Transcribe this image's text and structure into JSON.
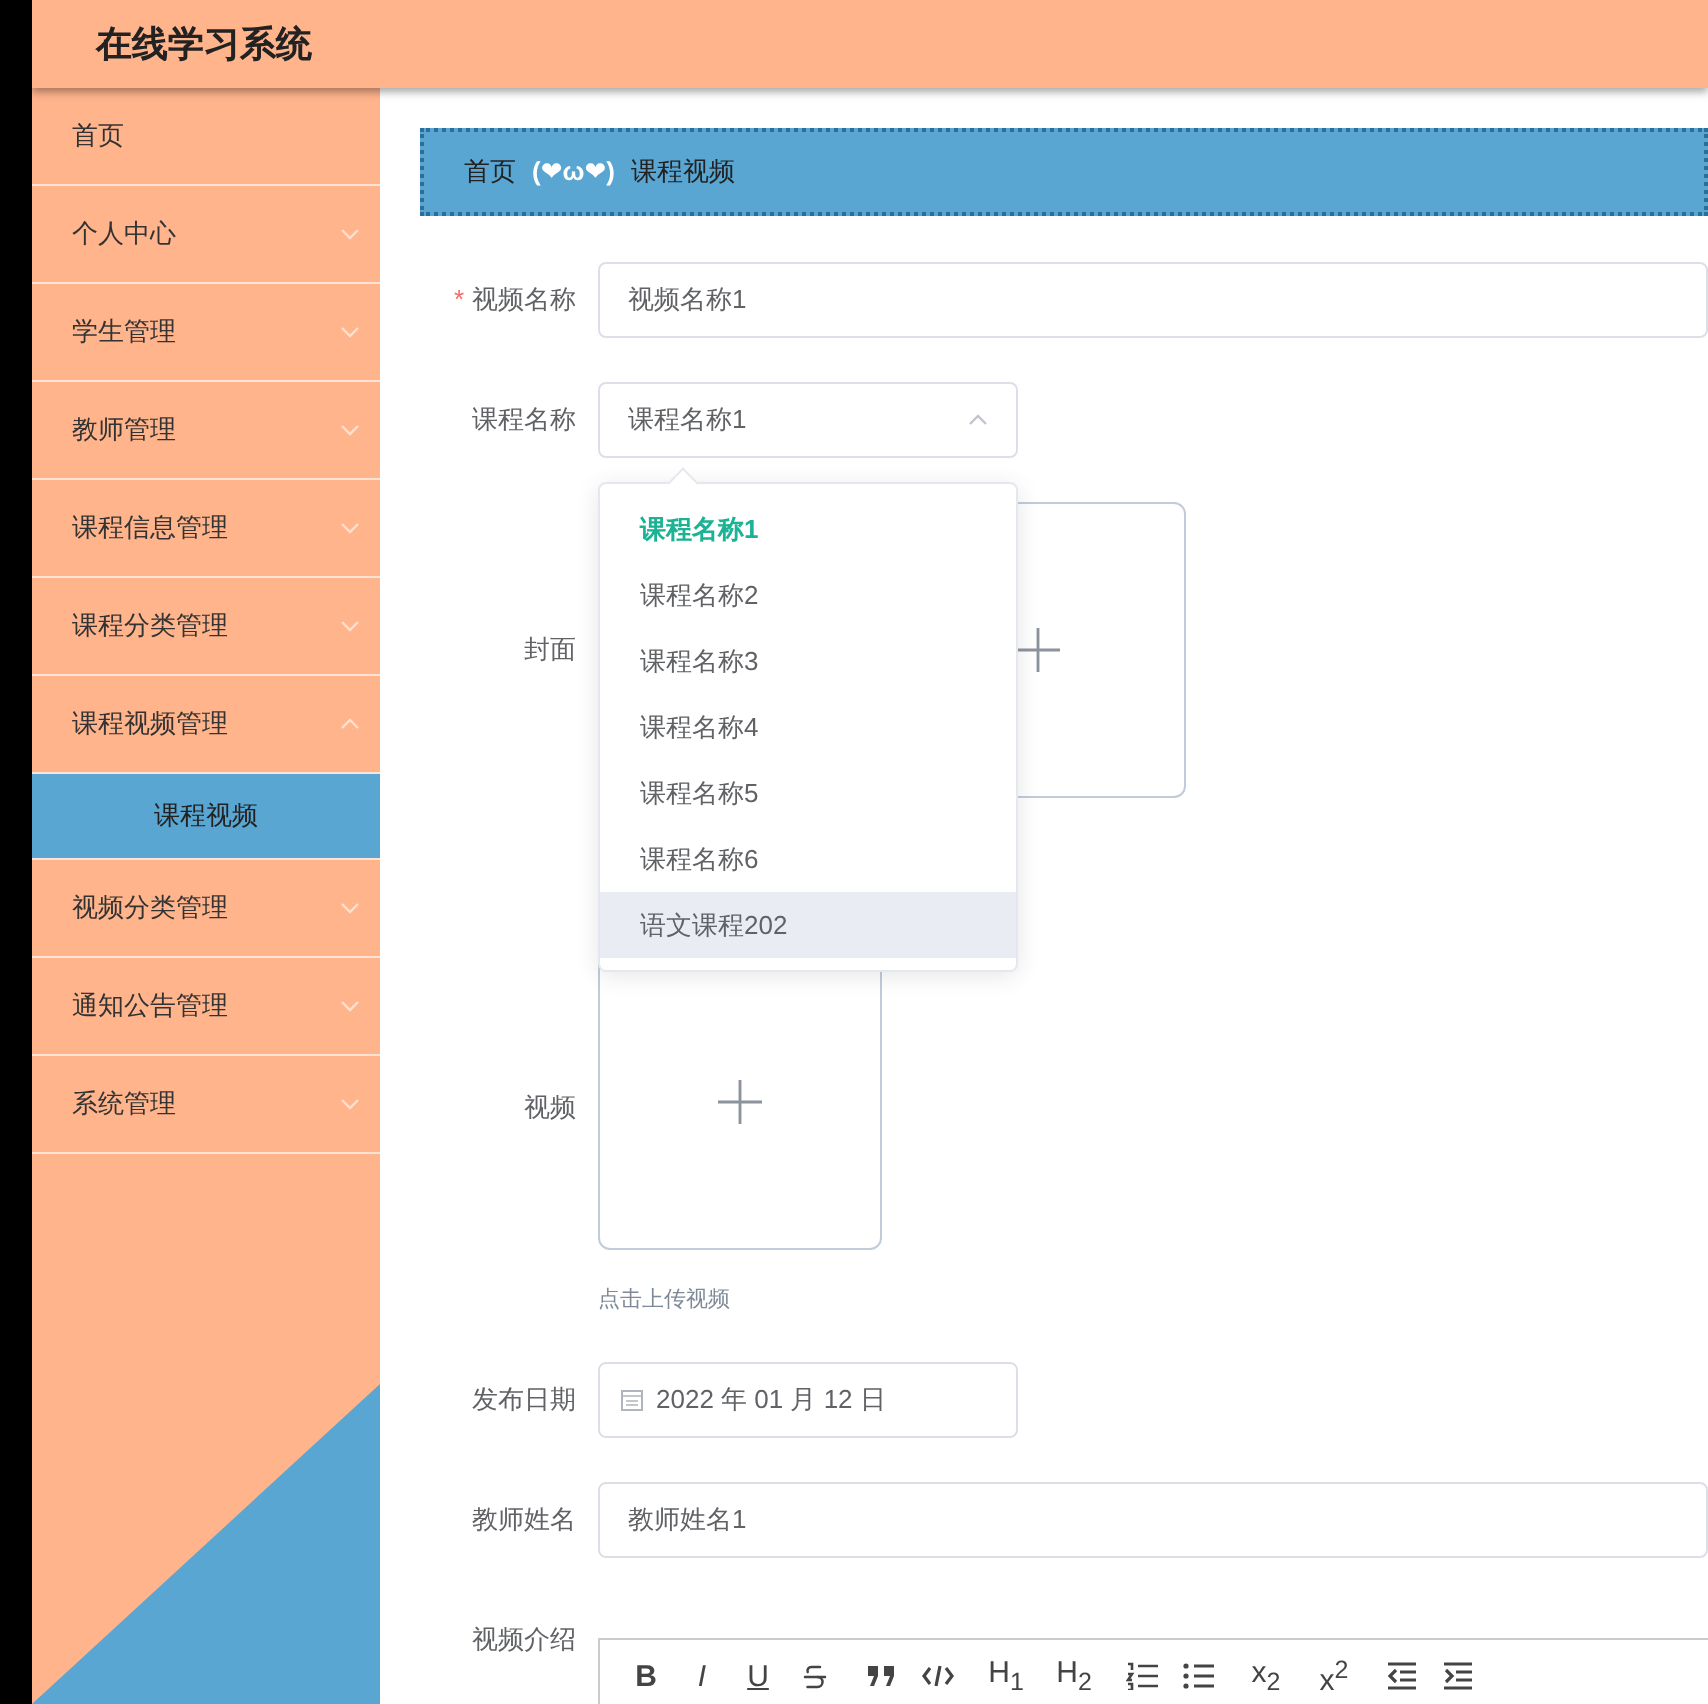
{
  "header": {
    "title": "在线学习系统"
  },
  "sidebar": {
    "items": [
      {
        "label": "首页",
        "kind": "link"
      },
      {
        "label": "个人中心",
        "kind": "menu",
        "expanded": false
      },
      {
        "label": "学生管理",
        "kind": "menu",
        "expanded": false
      },
      {
        "label": "教师管理",
        "kind": "menu",
        "expanded": false
      },
      {
        "label": "课程信息管理",
        "kind": "menu",
        "expanded": false
      },
      {
        "label": "课程分类管理",
        "kind": "menu",
        "expanded": false
      },
      {
        "label": "课程视频管理",
        "kind": "menu",
        "expanded": true,
        "children": [
          {
            "label": "课程视频",
            "selected": true
          }
        ]
      },
      {
        "label": "视频分类管理",
        "kind": "menu",
        "expanded": false
      },
      {
        "label": "通知公告管理",
        "kind": "menu",
        "expanded": false
      },
      {
        "label": "系统管理",
        "kind": "menu",
        "expanded": false
      }
    ]
  },
  "breadcrumb": {
    "home": "首页",
    "separator": "(❤ω❤)",
    "current": "课程视频"
  },
  "form": {
    "video_name": {
      "label": "视频名称",
      "required_mark": "*",
      "value": "视频名称1"
    },
    "course_name": {
      "label": "课程名称",
      "value": "课程名称1",
      "expanded": true,
      "options": [
        {
          "label": "课程名称1",
          "selected": true,
          "hovered": false
        },
        {
          "label": "课程名称2",
          "selected": false,
          "hovered": false
        },
        {
          "label": "课程名称3",
          "selected": false,
          "hovered": false
        },
        {
          "label": "课程名称4",
          "selected": false,
          "hovered": false
        },
        {
          "label": "课程名称5",
          "selected": false,
          "hovered": false
        },
        {
          "label": "课程名称6",
          "selected": false,
          "hovered": false
        },
        {
          "label": "语文课程202",
          "selected": false,
          "hovered": true
        }
      ]
    },
    "cover": {
      "label": "封面"
    },
    "video": {
      "label": "视频",
      "hint": "点击上传视频"
    },
    "publish_date": {
      "label": "发布日期",
      "value": "2022 年 01 月 12 日"
    },
    "teacher_name": {
      "label": "教师姓名",
      "value": "教师姓名1"
    },
    "intro": {
      "label": "视频介绍",
      "toolbar": [
        {
          "kind": "bold",
          "label": "B"
        },
        {
          "kind": "italic",
          "label": "I"
        },
        {
          "kind": "underline",
          "label": "U"
        },
        {
          "kind": "strike"
        },
        {
          "kind": "quote"
        },
        {
          "kind": "code"
        },
        {
          "kind": "text",
          "label": "H$_{1}$"
        },
        {
          "kind": "text",
          "label": "H$_{2}$"
        },
        {
          "kind": "ordered-list"
        },
        {
          "kind": "bullet-list"
        },
        {
          "kind": "text",
          "label": "x$_{2}$"
        },
        {
          "kind": "text",
          "label": "x$^{2}$"
        },
        {
          "kind": "outdent"
        },
        {
          "kind": "indent"
        }
      ]
    }
  }
}
